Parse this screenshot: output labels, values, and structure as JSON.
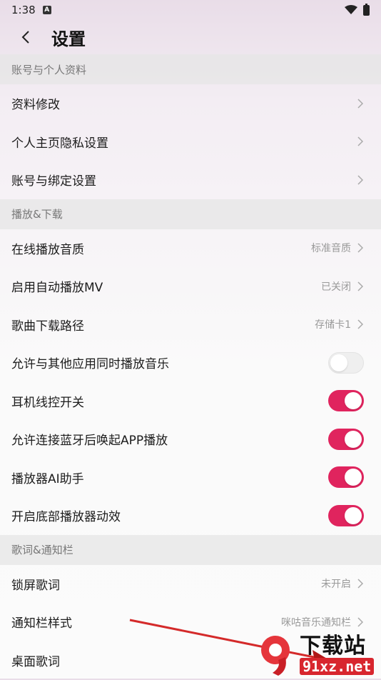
{
  "status_bar": {
    "time": "1:38",
    "notif_letter": "A"
  },
  "header": {
    "title": "设置"
  },
  "sections": [
    {
      "title": "账号与个人资料",
      "items": [
        {
          "label": "资料修改"
        },
        {
          "label": "个人主页隐私设置"
        },
        {
          "label": "账号与绑定设置"
        }
      ]
    },
    {
      "title": "播放&下载",
      "items": [
        {
          "label": "在线播放音质",
          "value": "标准音质"
        },
        {
          "label": "启用自动播放MV",
          "value": "已关闭"
        },
        {
          "label": "歌曲下载路径",
          "value": "存储卡1"
        },
        {
          "label": "允许与其他应用同时播放音乐",
          "toggle": "off"
        },
        {
          "label": "耳机线控开关",
          "toggle": "on"
        },
        {
          "label": "允许连接蓝牙后唤起APP播放",
          "toggle": "on"
        },
        {
          "label": "播放器AI助手",
          "toggle": "on"
        },
        {
          "label": "开启底部播放器动效",
          "toggle": "on"
        }
      ]
    },
    {
      "title": "歌词&通知栏",
      "items": [
        {
          "label": "锁屏歌词",
          "value": "未开启"
        },
        {
          "label": "通知栏样式",
          "value": "咪咕音乐通知栏"
        },
        {
          "label": "桌面歌词"
        }
      ]
    }
  ],
  "watermark": {
    "top": "下载站",
    "bottom": "91xz.net"
  },
  "colors": {
    "accent": "#e0245e",
    "annotation_arrow": "#d42a2a"
  }
}
